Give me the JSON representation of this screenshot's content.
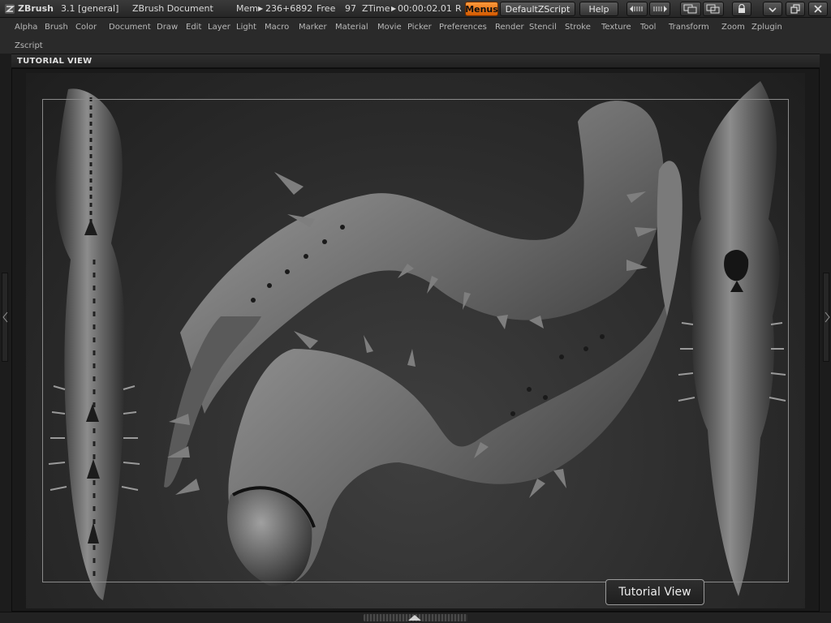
{
  "titlebar": {
    "app": "ZBrush",
    "version": "3.1 [general]",
    "document": "ZBrush Document",
    "mem_label": "Mem",
    "mem_value": "236+6892",
    "free_label": "Free",
    "free_value": "97",
    "ztime_label": "ZTime",
    "ztime_value": "00:00:02.01",
    "rec_marker": "R",
    "buttons": {
      "menus": "Menus",
      "default_zscript": "DefaultZScript",
      "help": "Help"
    }
  },
  "menubar": {
    "items": [
      "Alpha",
      "Brush",
      "Color",
      "Document",
      "Draw",
      "Edit",
      "Layer",
      "Light",
      "Macro",
      "Marker",
      "Material",
      "Movie",
      "Picker",
      "Preferences",
      "Render",
      "Stencil",
      "Stroke",
      "Texture",
      "Tool",
      "Transform",
      "Zoom",
      "Zplugin"
    ],
    "second_row": [
      "Zscript"
    ]
  },
  "tutorial_strip": {
    "title": "TUTORIAL VIEW"
  },
  "tooltip": {
    "text": "Tutorial View"
  },
  "colors": {
    "accent": "#e87511",
    "canvas_bg": "#2e2e2e",
    "model": "#8a8a8a"
  }
}
